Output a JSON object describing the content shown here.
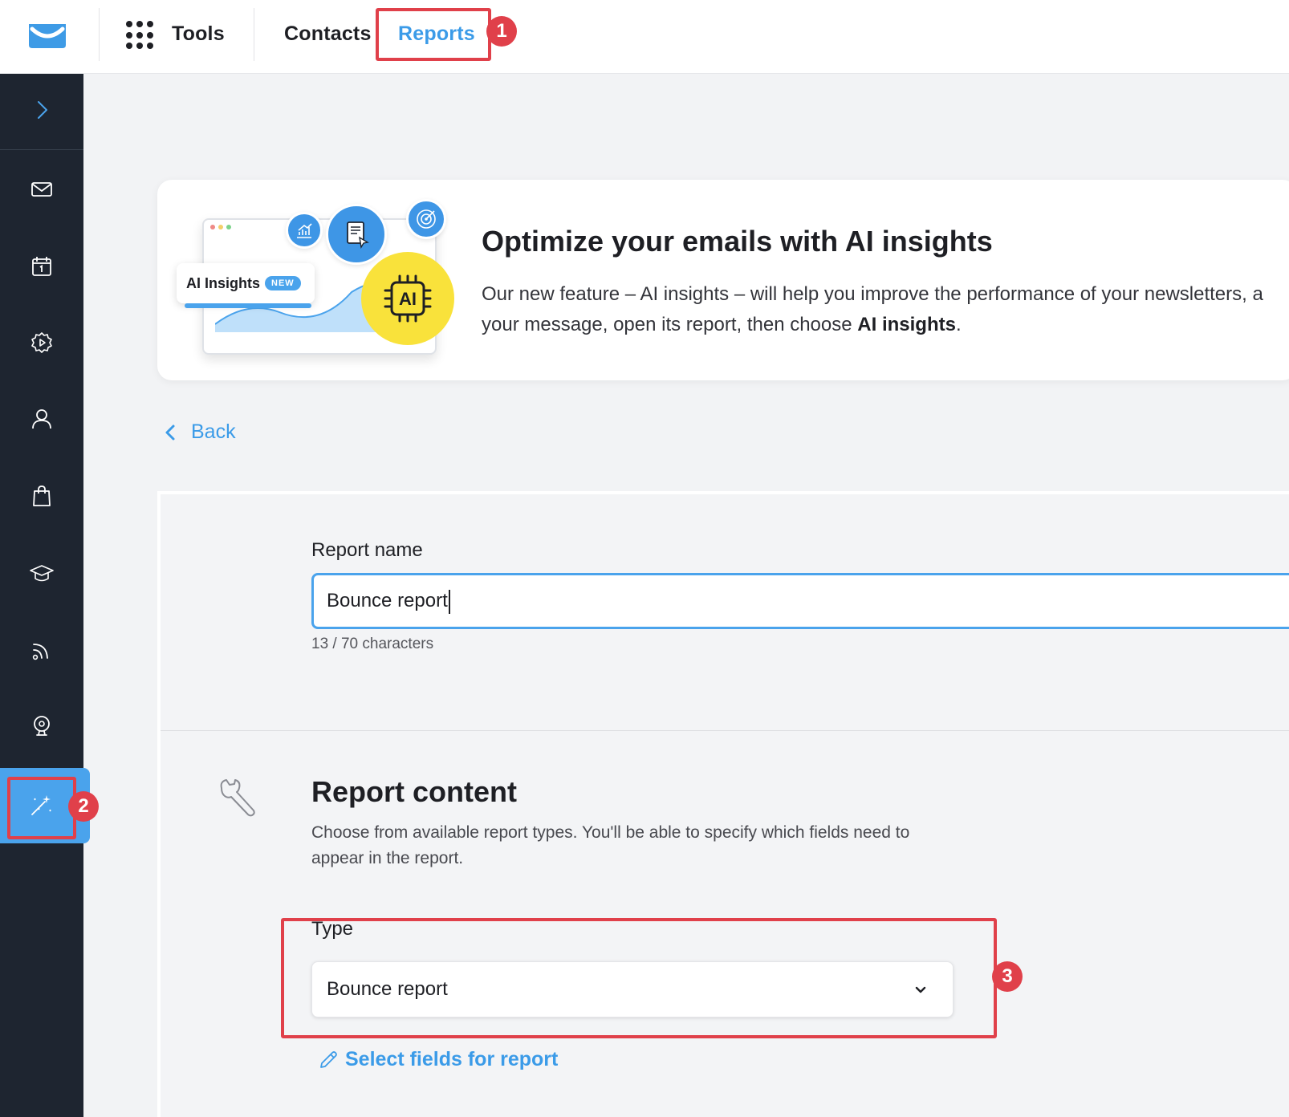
{
  "topnav": {
    "tools_label": "Tools",
    "contacts_label": "Contacts",
    "reports_label": "Reports"
  },
  "annotations": [
    "1",
    "2",
    "3"
  ],
  "sidebar": {
    "items": [
      "expand-chevron-icon",
      "mail-icon",
      "calendar-icon",
      "automation-gear-icon",
      "contacts-person-icon",
      "ecommerce-bag-icon",
      "education-cap-icon",
      "rss-icon",
      "webinar-icon",
      "magic-wand-icon"
    ],
    "active": "magic-wand-icon"
  },
  "banner": {
    "pill_label": "AI Insights",
    "pill_badge": "NEW",
    "chip_label": "AI",
    "title": "Optimize your emails with AI insights",
    "text_before": "Our new feature – AI insights – will help you improve the performance of your newsletters, a",
    "text_line2": "your message, open its report, then choose ",
    "text_bold": "AI insights",
    "text_after": "."
  },
  "back": {
    "label": "Back"
  },
  "form": {
    "report_name_label": "Report name",
    "report_name_value": "Bounce report",
    "char_count": "13 / 70 characters",
    "section_title": "Report content",
    "section_desc": "Choose from available report types. You'll be able to specify which fields need to appear in the report.",
    "type_label": "Type",
    "type_value": "Bounce report",
    "select_fields_label": "Select fields for report"
  },
  "colors": {
    "accent": "#3b9be8",
    "sidebar_bg": "#1e2530",
    "highlight": "#e0404a",
    "ai_chip": "#f9e23b"
  }
}
